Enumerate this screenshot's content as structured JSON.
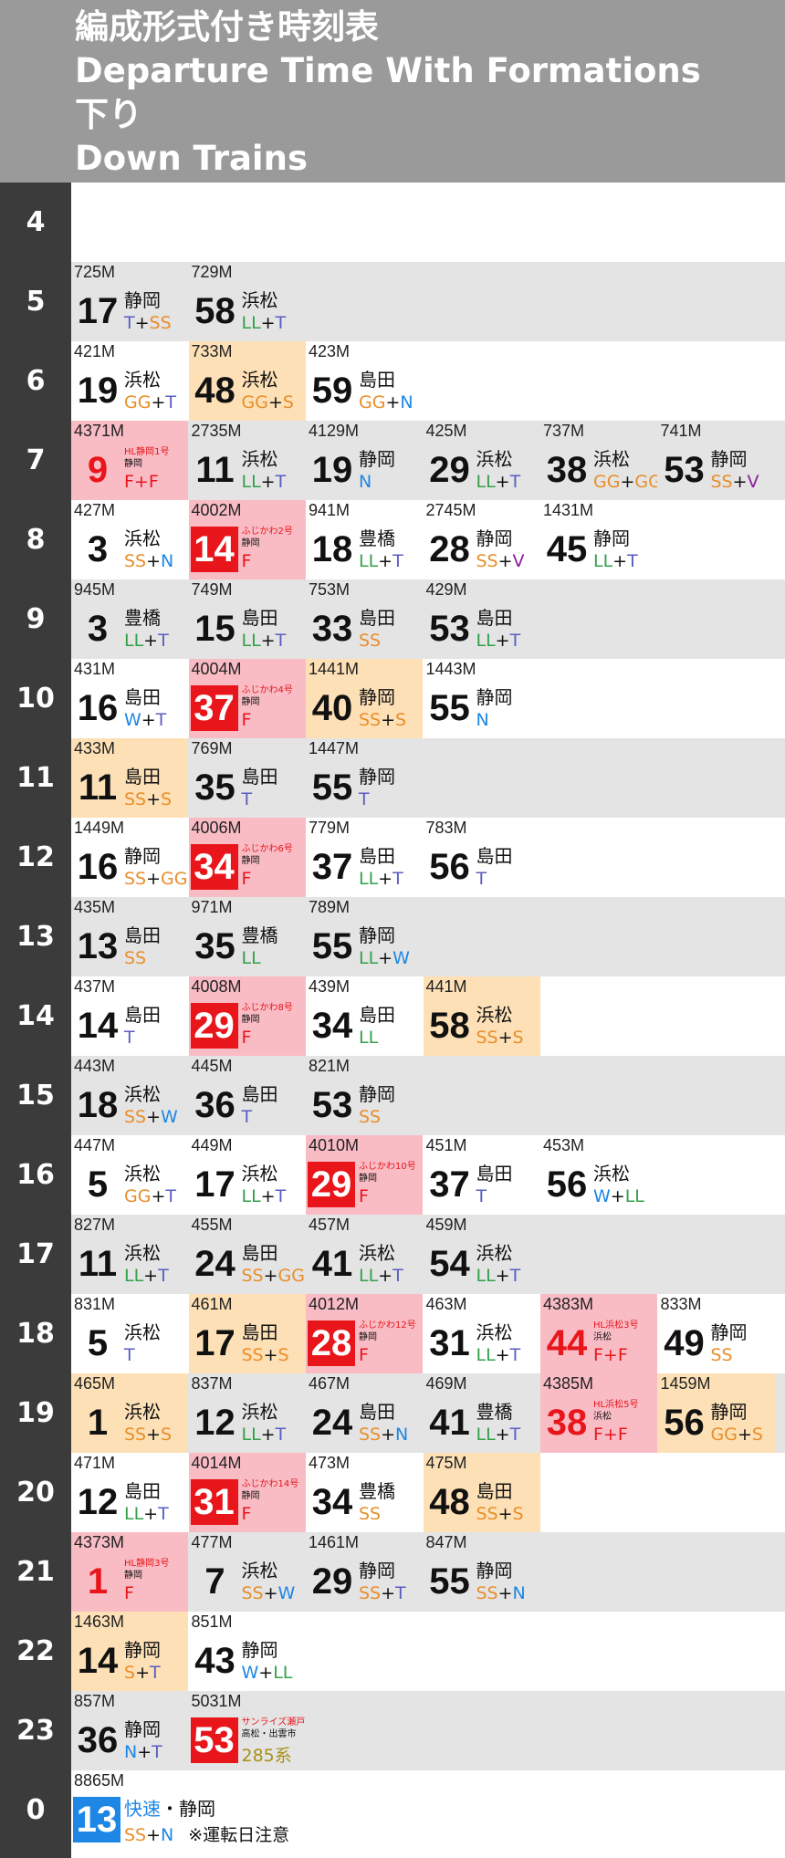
{
  "header": {
    "title_ja": "編成形式付き時刻表",
    "title_en": "Departure Time With Formations",
    "direction_ja": "下り",
    "direction_en": "Down Trains"
  },
  "colors": {
    "header_bg": "#9a9a9a",
    "hour_bg": "#3b3b3b",
    "row_alt": "#e4e4e4",
    "peach": "#fde0b6",
    "pink": "#f9bcc5",
    "red": "#e8151b",
    "blue": "#1e87e5",
    "SS": "#e98e2a",
    "GG": "#e98e2a",
    "S": "#e98e2a",
    "LL": "#33a04a",
    "T": "#5a5cc2",
    "N": "#1e87e5",
    "W": "#1e87e5",
    "V": "#8a1d9c",
    "plus": "#111111"
  },
  "hours": [
    {
      "hour": "4",
      "trains": []
    },
    {
      "hour": "5",
      "trains": [
        {
          "no": "725M",
          "min": "17",
          "dest": "静岡",
          "form": [
            "T",
            "SS"
          ]
        },
        {
          "no": "729M",
          "min": "58",
          "dest": "浜松",
          "form": [
            "LL",
            "T"
          ]
        }
      ]
    },
    {
      "hour": "6",
      "trains": [
        {
          "no": "421M",
          "min": "19",
          "dest": "浜松",
          "form": [
            "GG",
            "T"
          ]
        },
        {
          "no": "733M",
          "min": "48",
          "dest": "浜松",
          "form": [
            "GG",
            "S"
          ],
          "bg": "peach"
        },
        {
          "no": "423M",
          "min": "59",
          "dest": "島田",
          "form": [
            "GG",
            "N"
          ]
        }
      ]
    },
    {
      "hour": "7",
      "trains": [
        {
          "no": "4371M",
          "min": "9",
          "bg": "pink",
          "minStyle": "red-text",
          "sname": "HL静岡1号",
          "sdest": "静岡",
          "sform": "F+F"
        },
        {
          "no": "2735M",
          "min": "11",
          "dest": "浜松",
          "form": [
            "LL",
            "T"
          ]
        },
        {
          "no": "4129M",
          "min": "19",
          "dest": "静岡",
          "form": [
            "N"
          ]
        },
        {
          "no": "425M",
          "min": "29",
          "dest": "浜松",
          "form": [
            "LL",
            "T"
          ]
        },
        {
          "no": "737M",
          "min": "38",
          "dest": "浜松",
          "form": [
            "GG",
            "GG"
          ]
        },
        {
          "no": "741M",
          "min": "53",
          "dest": "静岡",
          "form": [
            "SS",
            "V"
          ]
        }
      ]
    },
    {
      "hour": "8",
      "trains": [
        {
          "no": "427M",
          "min": "3",
          "dest": "浜松",
          "form": [
            "SS",
            "N"
          ]
        },
        {
          "no": "4002M",
          "min": "14",
          "bg": "pink",
          "minStyle": "red-box",
          "sname": "ふじかわ2号",
          "sdest": "静岡",
          "sform": "F"
        },
        {
          "no": "941M",
          "min": "18",
          "dest": "豊橋",
          "form": [
            "LL",
            "T"
          ]
        },
        {
          "no": "2745M",
          "min": "28",
          "dest": "静岡",
          "form": [
            "SS",
            "V"
          ]
        },
        {
          "no": "1431M",
          "min": "45",
          "dest": "静岡",
          "form": [
            "LL",
            "T"
          ]
        }
      ]
    },
    {
      "hour": "9",
      "trains": [
        {
          "no": "945M",
          "min": "3",
          "dest": "豊橋",
          "form": [
            "LL",
            "T"
          ]
        },
        {
          "no": "749M",
          "min": "15",
          "dest": "島田",
          "form": [
            "LL",
            "T"
          ]
        },
        {
          "no": "753M",
          "min": "33",
          "dest": "島田",
          "form": [
            "SS"
          ]
        },
        {
          "no": "429M",
          "min": "53",
          "dest": "島田",
          "form": [
            "LL",
            "T"
          ]
        }
      ]
    },
    {
      "hour": "10",
      "trains": [
        {
          "no": "431M",
          "min": "16",
          "dest": "島田",
          "form": [
            "W",
            "T"
          ]
        },
        {
          "no": "4004M",
          "min": "37",
          "bg": "pink",
          "minStyle": "red-box",
          "sname": "ふじかわ4号",
          "sdest": "静岡",
          "sform": "F"
        },
        {
          "no": "1441M",
          "min": "40",
          "dest": "静岡",
          "form": [
            "SS",
            "S"
          ],
          "bg": "peach"
        },
        {
          "no": "1443M",
          "min": "55",
          "dest": "静岡",
          "form": [
            "N"
          ]
        }
      ]
    },
    {
      "hour": "11",
      "trains": [
        {
          "no": "433M",
          "min": "11",
          "dest": "島田",
          "form": [
            "SS",
            "S"
          ],
          "bg": "peach"
        },
        {
          "no": "769M",
          "min": "35",
          "dest": "島田",
          "form": [
            "T"
          ]
        },
        {
          "no": "1447M",
          "min": "55",
          "dest": "静岡",
          "form": [
            "T"
          ]
        }
      ]
    },
    {
      "hour": "12",
      "trains": [
        {
          "no": "1449M",
          "min": "16",
          "dest": "静岡",
          "form": [
            "SS",
            "GG"
          ]
        },
        {
          "no": "4006M",
          "min": "34",
          "bg": "pink",
          "minStyle": "red-box",
          "sname": "ふじかわ6号",
          "sdest": "静岡",
          "sform": "F"
        },
        {
          "no": "779M",
          "min": "37",
          "dest": "島田",
          "form": [
            "LL",
            "T"
          ]
        },
        {
          "no": "783M",
          "min": "56",
          "dest": "島田",
          "form": [
            "T"
          ]
        }
      ]
    },
    {
      "hour": "13",
      "trains": [
        {
          "no": "435M",
          "min": "13",
          "dest": "島田",
          "form": [
            "SS"
          ]
        },
        {
          "no": "971M",
          "min": "35",
          "dest": "豊橋",
          "form": [
            "LL"
          ]
        },
        {
          "no": "789M",
          "min": "55",
          "dest": "静岡",
          "form": [
            "LL",
            "W"
          ]
        }
      ]
    },
    {
      "hour": "14",
      "trains": [
        {
          "no": "437M",
          "min": "14",
          "dest": "島田",
          "form": [
            "T"
          ]
        },
        {
          "no": "4008M",
          "min": "29",
          "bg": "pink",
          "minStyle": "red-box",
          "sname": "ふじかわ8号",
          "sdest": "静岡",
          "sform": "F"
        },
        {
          "no": "439M",
          "min": "34",
          "dest": "島田",
          "form": [
            "LL"
          ]
        },
        {
          "no": "441M",
          "min": "58",
          "dest": "浜松",
          "form": [
            "SS",
            "S"
          ],
          "bg": "peach"
        }
      ]
    },
    {
      "hour": "15",
      "trains": [
        {
          "no": "443M",
          "min": "18",
          "dest": "浜松",
          "form": [
            "SS",
            "W"
          ]
        },
        {
          "no": "445M",
          "min": "36",
          "dest": "島田",
          "form": [
            "T"
          ]
        },
        {
          "no": "821M",
          "min": "53",
          "dest": "静岡",
          "form": [
            "SS"
          ]
        }
      ]
    },
    {
      "hour": "16",
      "trains": [
        {
          "no": "447M",
          "min": "5",
          "dest": "浜松",
          "form": [
            "GG",
            "T"
          ]
        },
        {
          "no": "449M",
          "min": "17",
          "dest": "浜松",
          "form": [
            "LL",
            "T"
          ]
        },
        {
          "no": "4010M",
          "min": "29",
          "bg": "pink",
          "minStyle": "red-box",
          "sname": "ふじかわ10号",
          "sdest": "静岡",
          "sform": "F"
        },
        {
          "no": "451M",
          "min": "37",
          "dest": "島田",
          "form": [
            "T"
          ]
        },
        {
          "no": "453M",
          "min": "56",
          "dest": "浜松",
          "form": [
            "W",
            "LL"
          ]
        }
      ]
    },
    {
      "hour": "17",
      "trains": [
        {
          "no": "827M",
          "min": "11",
          "dest": "浜松",
          "form": [
            "LL",
            "T"
          ]
        },
        {
          "no": "455M",
          "min": "24",
          "dest": "島田",
          "form": [
            "SS",
            "GG"
          ]
        },
        {
          "no": "457M",
          "min": "41",
          "dest": "浜松",
          "form": [
            "LL",
            "T"
          ]
        },
        {
          "no": "459M",
          "min": "54",
          "dest": "浜松",
          "form": [
            "LL",
            "T"
          ]
        }
      ]
    },
    {
      "hour": "18",
      "trains": [
        {
          "no": "831M",
          "min": "5",
          "dest": "浜松",
          "form": [
            "T"
          ]
        },
        {
          "no": "461M",
          "min": "17",
          "dest": "島田",
          "form": [
            "SS",
            "S"
          ],
          "bg": "peach"
        },
        {
          "no": "4012M",
          "min": "28",
          "bg": "pink",
          "minStyle": "red-box",
          "sname": "ふじかわ12号",
          "sdest": "静岡",
          "sform": "F"
        },
        {
          "no": "463M",
          "min": "31",
          "dest": "浜松",
          "form": [
            "LL",
            "T"
          ]
        },
        {
          "no": "4383M",
          "min": "44",
          "bg": "pink",
          "minStyle": "red-text",
          "sname": "HL浜松3号",
          "sdest": "浜松",
          "sform": "F+F"
        },
        {
          "no": "833M",
          "min": "49",
          "dest": "静岡",
          "form": [
            "SS"
          ]
        }
      ]
    },
    {
      "hour": "19",
      "trains": [
        {
          "no": "465M",
          "min": "1",
          "dest": "浜松",
          "form": [
            "SS",
            "S"
          ],
          "bg": "peach"
        },
        {
          "no": "837M",
          "min": "12",
          "dest": "浜松",
          "form": [
            "LL",
            "T"
          ]
        },
        {
          "no": "467M",
          "min": "24",
          "dest": "島田",
          "form": [
            "SS",
            "N"
          ]
        },
        {
          "no": "469M",
          "min": "41",
          "dest": "豊橋",
          "form": [
            "LL",
            "T"
          ]
        },
        {
          "no": "4385M",
          "min": "38",
          "bg": "pink",
          "minStyle": "red-text",
          "sname": "HL浜松5号",
          "sdest": "浜松",
          "sform": "F+F"
        },
        {
          "no": "1459M",
          "min": "56",
          "dest": "静岡",
          "form": [
            "GG",
            "S"
          ],
          "bg": "peach"
        }
      ]
    },
    {
      "hour": "20",
      "trains": [
        {
          "no": "471M",
          "min": "12",
          "dest": "島田",
          "form": [
            "LL",
            "T"
          ]
        },
        {
          "no": "4014M",
          "min": "31",
          "bg": "pink",
          "minStyle": "red-box",
          "sname": "ふじかわ14号",
          "sdest": "静岡",
          "sform": "F"
        },
        {
          "no": "473M",
          "min": "34",
          "dest": "豊橋",
          "form": [
            "SS"
          ]
        },
        {
          "no": "475M",
          "min": "48",
          "dest": "島田",
          "form": [
            "SS",
            "S"
          ],
          "bg": "peach"
        }
      ]
    },
    {
      "hour": "21",
      "trains": [
        {
          "no": "4373M",
          "min": "1",
          "bg": "pink",
          "minStyle": "red-text",
          "sname": "HL静岡3号",
          "sdest": "静岡",
          "sform": "F"
        },
        {
          "no": "477M",
          "min": "7",
          "dest": "浜松",
          "form": [
            "SS",
            "W"
          ]
        },
        {
          "no": "1461M",
          "min": "29",
          "dest": "静岡",
          "form": [
            "SS",
            "T"
          ]
        },
        {
          "no": "847M",
          "min": "55",
          "dest": "静岡",
          "form": [
            "SS",
            "N"
          ]
        }
      ]
    },
    {
      "hour": "22",
      "trains": [
        {
          "no": "1463M",
          "min": "14",
          "dest": "静岡",
          "form": [
            "S",
            "T"
          ],
          "bg": "peach"
        },
        {
          "no": "851M",
          "min": "43",
          "dest": "静岡",
          "form": [
            "W",
            "LL"
          ]
        }
      ]
    },
    {
      "hour": "23",
      "trains": [
        {
          "no": "857M",
          "min": "36",
          "dest": "静岡",
          "form": [
            "N",
            "T"
          ]
        },
        {
          "no": "5031M",
          "min": "53",
          "minStyle": "red-box",
          "sname": "サンライズ瀬戸・出雲",
          "sdest": "高松・出雲市",
          "sunrise": "285系"
        }
      ]
    },
    {
      "hour": "0",
      "trains": [
        {
          "no": "8865M",
          "min": "13",
          "minStyle": "blue-box",
          "rapid": "快速",
          "rapidDest": "・静岡",
          "form": [
            "SS",
            "N"
          ],
          "note": "※運転日注意"
        }
      ]
    }
  ]
}
